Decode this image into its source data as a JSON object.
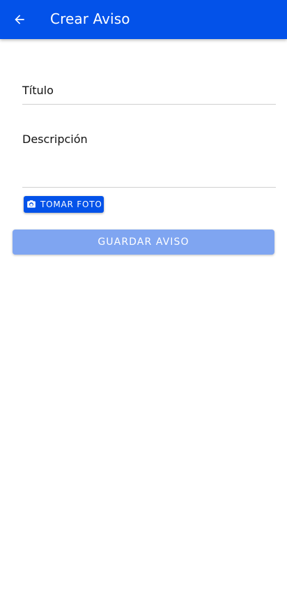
{
  "appbar": {
    "title": "Crear Aviso",
    "back_icon": "arrow-back-icon",
    "background_color": "#0352e9"
  },
  "form": {
    "title_field": {
      "label": "Título",
      "value": ""
    },
    "description_field": {
      "label": "Descripción",
      "value": ""
    },
    "photo_button": {
      "label": "TOMAR FOTO",
      "icon": "camera-icon",
      "color": "#0352e9"
    },
    "save_button": {
      "label": "GUARDAR AVISO",
      "color": "#7fa5f1",
      "state": "disabled"
    }
  }
}
